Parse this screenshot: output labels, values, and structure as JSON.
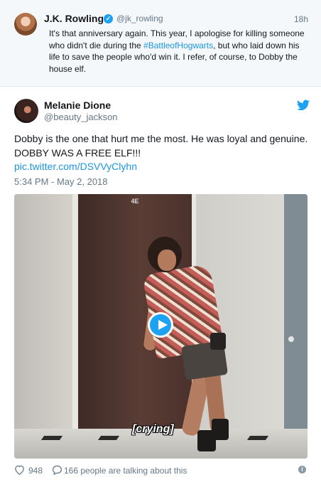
{
  "quoted_tweet": {
    "name": "J.K. Rowling",
    "handle": "@jk_rowling",
    "time": "18h",
    "text_before": "It's that anniversary again. This year, I apologise for killing someone who didn't die during the ",
    "hashtag": "#BattleofHogwarts",
    "text_after": ", but who laid down his life to save the people who'd win it. I refer, of course, to Dobby the house elf."
  },
  "main_tweet": {
    "name": "Melanie Dione",
    "handle": "@beauty_jackson",
    "text": "Dobby is the one that hurt me the most. He was loyal and genuine. DOBBY WAS A FREE ELF!!!",
    "link": "pic.twitter.com/DSVVyClyhn",
    "timestamp": "5:34 PM - May 2, 2018"
  },
  "media": {
    "door_number": "4E",
    "caption": "[crying]"
  },
  "footer": {
    "likes": "948",
    "talking": "166 people are talking about this",
    "info": "i"
  },
  "colors": {
    "accent": "#1da1f2",
    "link": "#1b95e0",
    "muted": "#657786"
  }
}
